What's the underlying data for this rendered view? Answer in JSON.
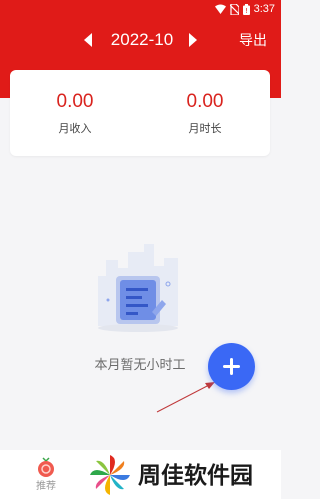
{
  "status_bar": {
    "time": "3:37"
  },
  "nav": {
    "month": "2022-10",
    "export_label": "导出"
  },
  "stats": {
    "income": {
      "value": "0.00",
      "label": "月收入"
    },
    "hours": {
      "value": "0.00",
      "label": "月时长"
    }
  },
  "empty_state": {
    "message": "本月暂无小时工"
  },
  "bottom_tab": {
    "label": "推荐"
  },
  "watermark": {
    "text": "周佳软件园"
  },
  "colors": {
    "header_red": "#e01b18",
    "value_red": "#d9231e",
    "fab_blue": "#3a68f5",
    "background": "#f5f5f7"
  },
  "icons": [
    "wifi-icon",
    "no-sim-icon",
    "battery-icon",
    "prev-month-icon",
    "next-month-icon",
    "plus-icon",
    "recommend-icon",
    "empty-document-icon"
  ]
}
